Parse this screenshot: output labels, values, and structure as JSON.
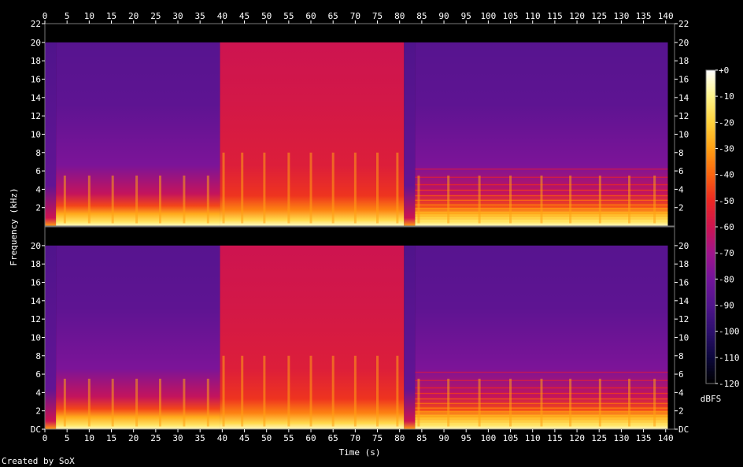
{
  "chart_data": {
    "type": "heatmap",
    "xlabel": "Time (s)",
    "ylabel": "Frequency (kHz)",
    "x_range": [
      0,
      142
    ],
    "x_ticks": [
      "0",
      "5",
      "10",
      "15",
      "20",
      "25",
      "30",
      "35",
      "40",
      "45",
      "50",
      "55",
      "60",
      "65",
      "70",
      "75",
      "80",
      "85",
      "90",
      "95",
      "100",
      "105",
      "110",
      "115",
      "120",
      "125",
      "130",
      "135",
      "140"
    ],
    "y_range_khz": [
      0,
      22.05
    ],
    "y_ticks_top": [
      "22",
      "20",
      "18",
      "16",
      "14",
      "12",
      "10",
      "8",
      "6",
      "4",
      "2"
    ],
    "y_ticks_bottom": [
      "20",
      "18",
      "16",
      "14",
      "12",
      "10",
      "8",
      "6",
      "4",
      "2",
      "DC"
    ],
    "channels": 2,
    "signal_cutoff_khz": 20,
    "colorbar": {
      "unit": "dBFS",
      "ticks": [
        "+0",
        "-10",
        "-20",
        "-30",
        "-40",
        "-50",
        "-60",
        "-70",
        "-80",
        "-90",
        "-100",
        "-110",
        "-120"
      ],
      "range_db": [
        -120,
        0
      ]
    },
    "segments": [
      {
        "start_s": 0,
        "end_s": 2.5,
        "energy": "low"
      },
      {
        "start_s": 2.5,
        "end_s": 39.5,
        "energy": "medium",
        "brightness_upper_khz": 4
      },
      {
        "start_s": 39.5,
        "end_s": 81,
        "energy": "high",
        "brightness_upper_khz": 20
      },
      {
        "start_s": 81,
        "end_s": 83.5,
        "energy": "low"
      },
      {
        "start_s": 83.5,
        "end_s": 140.5,
        "energy": "medium",
        "brightness_upper_khz": 7,
        "harmonic_bands": true
      },
      {
        "start_s": 140.5,
        "end_s": 142,
        "energy": "silence"
      }
    ],
    "note_onsets_s": [
      4.5,
      10,
      15.3,
      20.7,
      26,
      31.4,
      36.8,
      40.3,
      44.5,
      49.5,
      55,
      60,
      65,
      70,
      75,
      79.5,
      84.3,
      91,
      98,
      105,
      112,
      118.5,
      125.2,
      131.8,
      137.5
    ]
  },
  "credit": "Created by SoX"
}
